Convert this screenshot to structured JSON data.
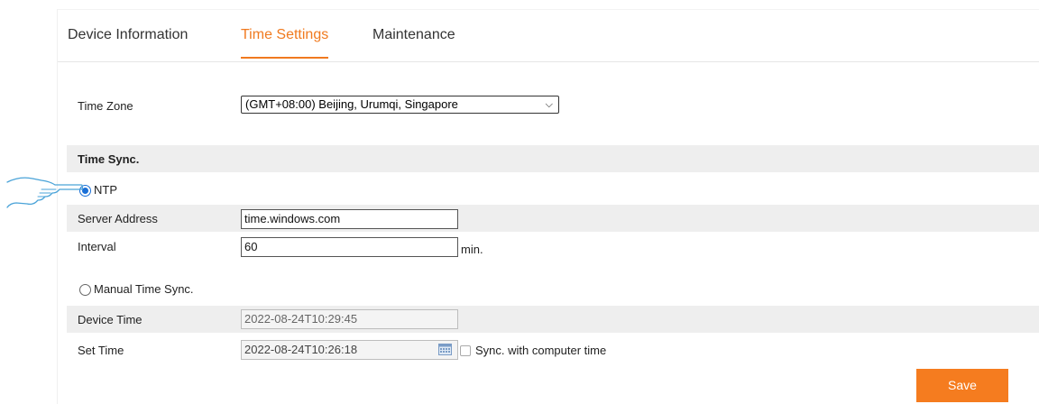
{
  "tabs": [
    {
      "label": "Device Information",
      "active": false
    },
    {
      "label": "Time Settings",
      "active": true
    },
    {
      "label": "Maintenance",
      "active": false
    }
  ],
  "time_zone": {
    "label": "Time Zone",
    "value": "(GMT+08:00) Beijing, Urumqi, Singapore"
  },
  "time_sync": {
    "section_title": "Time Sync.",
    "ntp": {
      "label": "NTP",
      "selected": true,
      "server_address_label": "Server Address",
      "server_address_value": "time.windows.com",
      "interval_label": "Interval",
      "interval_value": "60",
      "interval_unit": "min."
    },
    "manual": {
      "label": "Manual Time Sync.",
      "selected": false,
      "device_time_label": "Device Time",
      "device_time_value": "2022-08-24T10:29:45",
      "set_time_label": "Set Time",
      "set_time_value": "2022-08-24T10:26:18",
      "sync_computer_label": "Sync. with computer time",
      "sync_computer_checked": false
    }
  },
  "save_label": "Save",
  "colors": {
    "accent": "#f07a1f",
    "radio": "#1a6fd6",
    "hand_stroke": "#4aa3d8"
  }
}
